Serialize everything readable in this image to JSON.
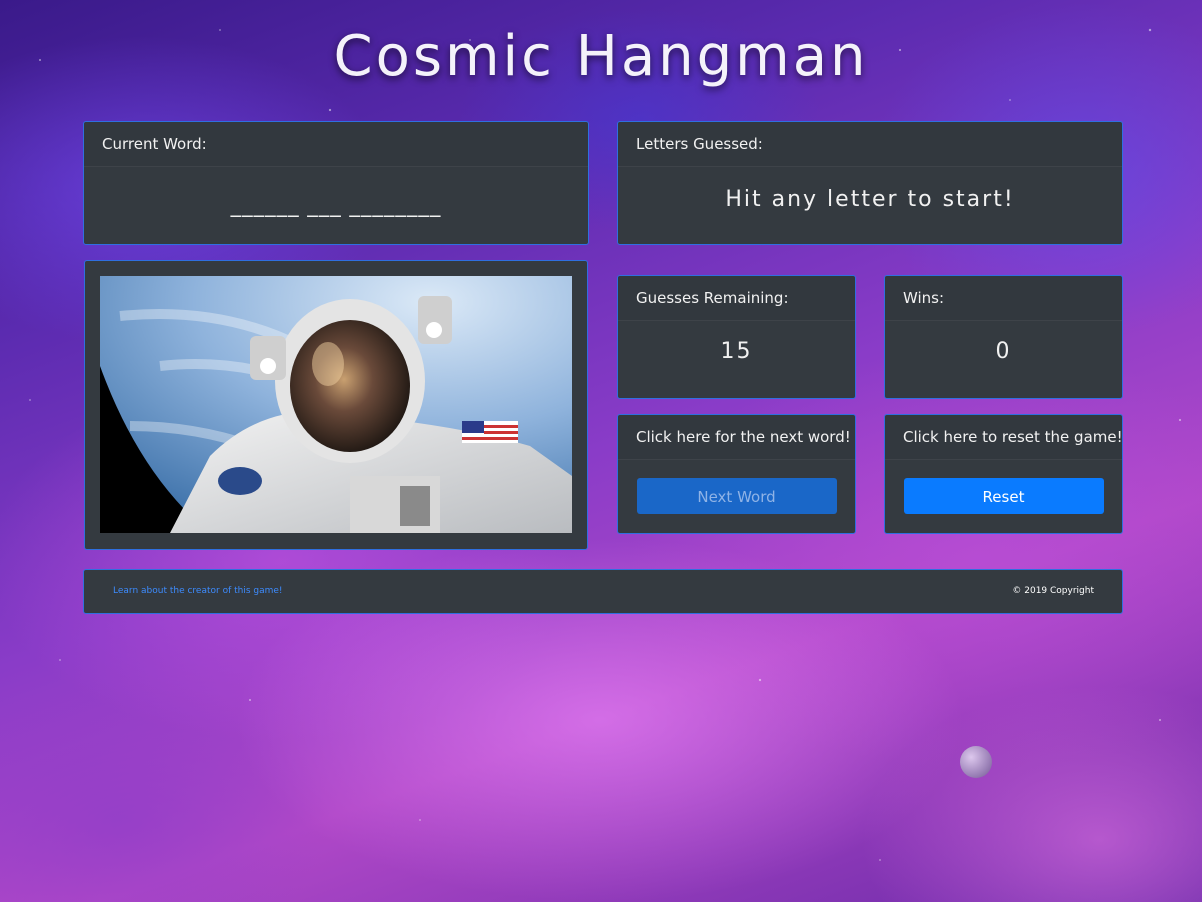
{
  "title": "Cosmic Hangman",
  "current_word": {
    "header": "Current Word:",
    "value": "______ ___ ________"
  },
  "letters_guessed": {
    "header": "Letters Guessed:",
    "value": "Hit any letter to start!"
  },
  "guesses_remaining": {
    "header": "Guesses Remaining:",
    "value": "15"
  },
  "wins": {
    "header": "Wins:",
    "value": "0"
  },
  "next_word": {
    "header": "Click here for the next word!",
    "button_label": "Next Word"
  },
  "reset": {
    "header": "Click here to reset the game!",
    "button_label": "Reset"
  },
  "footer": {
    "link_text": "Learn about the creator of this game!",
    "copyright": "© 2019 Copyright"
  },
  "colors": {
    "card_bg": "#343a40",
    "card_border": "#2f6fe0",
    "reset_button": "#0a7bff",
    "next_button": "#1a67c8"
  }
}
